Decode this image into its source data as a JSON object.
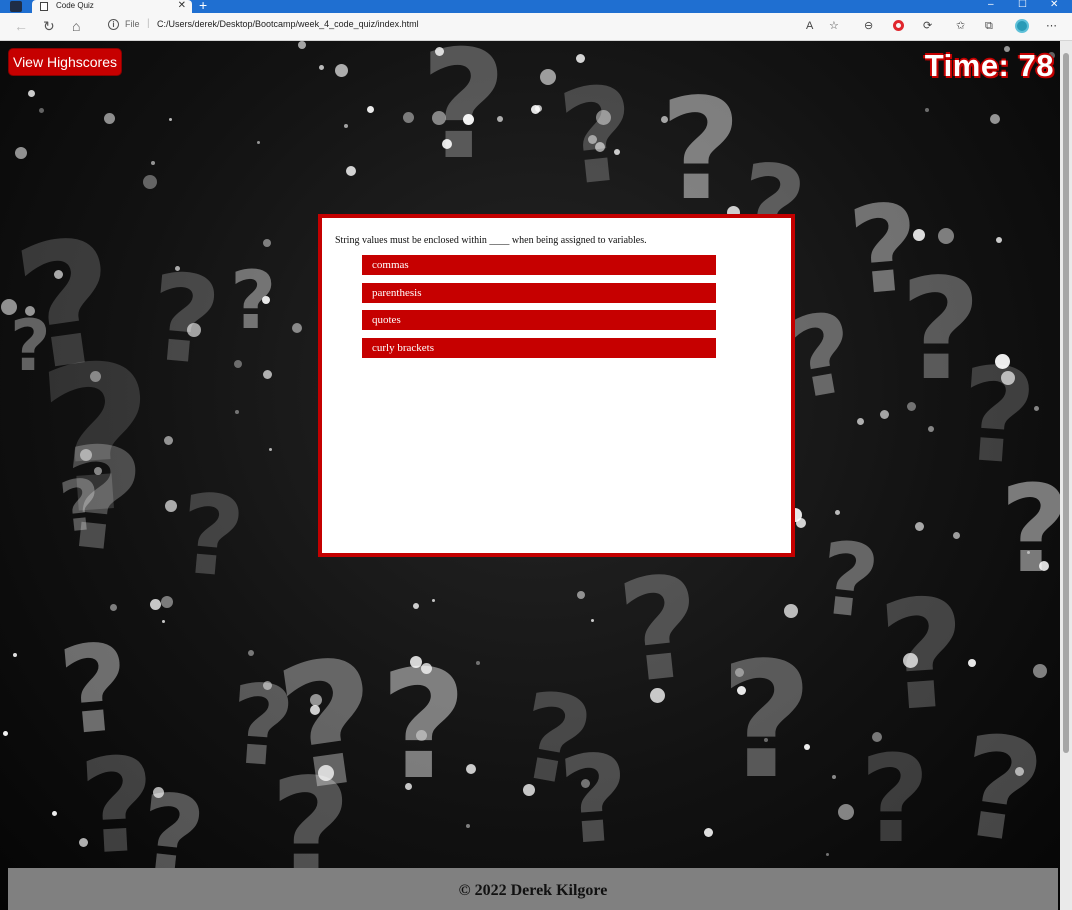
{
  "browser": {
    "tab_title": "Code Quiz",
    "tab_close": "✕",
    "new_tab": "+",
    "address_prefix": "File",
    "address_separator": "|",
    "url": "C:/Users/derek/Desktop/Bootcamp/week_4_code_quiz/index.html",
    "window_controls": [
      "–",
      "☐",
      "✕"
    ],
    "icons": [
      "back-arrow-icon",
      "reload-icon",
      "home-icon",
      "info-icon",
      "read-aloud-icon",
      "add-favorite-icon",
      "zoom-icon",
      "opera-icon",
      "extensions-icon",
      "favorites-icon",
      "collections-icon",
      "profile-icon",
      "more-icon"
    ]
  },
  "header": {
    "highscores_label": "View Highscores",
    "timer_label": "Time:",
    "timer_value": "78"
  },
  "quiz": {
    "question": "String values must be enclosed within ____ when being assigned to variables.",
    "choices": [
      "commas",
      "parenthesis",
      "quotes",
      "curly brackets"
    ]
  },
  "footer": {
    "text": "© 2022 Derek Kilgore"
  },
  "colors": {
    "accent_red": "#c60000",
    "footer_gray": "#808080",
    "browser_blue": "#1f6fd1"
  }
}
